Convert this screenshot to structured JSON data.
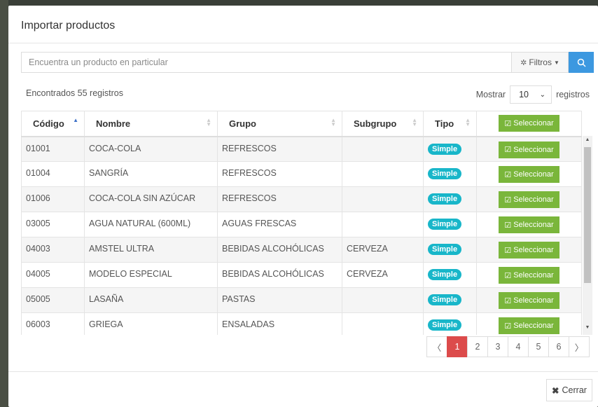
{
  "modal": {
    "title": "Importar productos",
    "search": {
      "placeholder": "Encuentra un producto en particular",
      "value": ""
    },
    "filters_label": "Filtros",
    "found_text": "Encontrados 55 registros",
    "show_label": "Mostrar",
    "page_length": "10",
    "records_label": "registros",
    "close_label": "Cerrar"
  },
  "table": {
    "headers": [
      "Código",
      "Nombre",
      "Grupo",
      "Subgrupo",
      "Tipo"
    ],
    "header_action": "Seleccionar",
    "rows": [
      {
        "codigo": "01001",
        "nombre": "COCA-COLA",
        "grupo": "REFRESCOS",
        "subgrupo": "",
        "tipo": "Simple",
        "action": "Seleccionar"
      },
      {
        "codigo": "01004",
        "nombre": "SANGRÍA",
        "grupo": "REFRESCOS",
        "subgrupo": "",
        "tipo": "Simple",
        "action": "Seleccionar"
      },
      {
        "codigo": "01006",
        "nombre": "COCA-COLA SIN AZÚCAR",
        "grupo": "REFRESCOS",
        "subgrupo": "",
        "tipo": "Simple",
        "action": "Seleccionar"
      },
      {
        "codigo": "03005",
        "nombre": "AGUA NATURAL (600ML)",
        "grupo": "AGUAS FRESCAS",
        "subgrupo": "",
        "tipo": "Simple",
        "action": "Seleccionar"
      },
      {
        "codigo": "04003",
        "nombre": "AMSTEL ULTRA",
        "grupo": "BEBIDAS ALCOHÓLICAS",
        "subgrupo": "CERVEZA",
        "tipo": "Simple",
        "action": "Seleccionar"
      },
      {
        "codigo": "04005",
        "nombre": "MODELO ESPECIAL",
        "grupo": "BEBIDAS ALCOHÓLICAS",
        "subgrupo": "CERVEZA",
        "tipo": "Simple",
        "action": "Seleccionar"
      },
      {
        "codigo": "05005",
        "nombre": "LASAÑA",
        "grupo": "PASTAS",
        "subgrupo": "",
        "tipo": "Simple",
        "action": "Seleccionar"
      },
      {
        "codigo": "06003",
        "nombre": "GRIEGA",
        "grupo": "ENSALADAS",
        "subgrupo": "",
        "tipo": "Simple",
        "action": "Seleccionar"
      }
    ]
  },
  "pagination": {
    "prev": "〈",
    "next": "〉",
    "pages": [
      "1",
      "2",
      "3",
      "4",
      "5",
      "6"
    ],
    "current": "1"
  },
  "colors": {
    "accent_blue": "#3c98e0",
    "select_green": "#7ab63b",
    "badge_teal": "#18b6c9",
    "active_page_red": "#dc4b4b"
  },
  "icons": {
    "filters": "wrench-icon",
    "search": "search-icon",
    "select": "check-square-icon",
    "close": "close-icon"
  }
}
